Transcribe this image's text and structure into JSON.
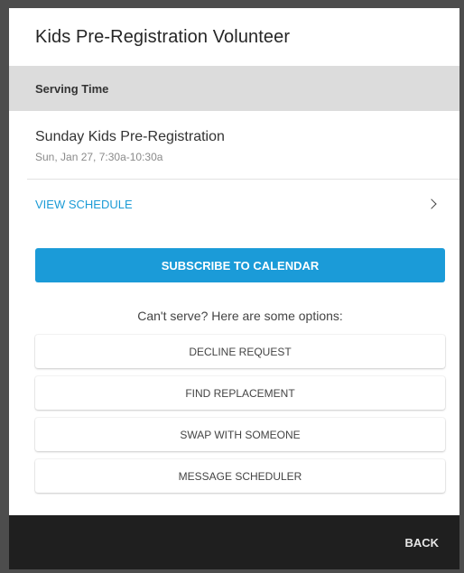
{
  "dialog": {
    "title": "Kids Pre-Registration Volunteer"
  },
  "section": {
    "header": "Serving Time"
  },
  "event": {
    "name": "Sunday Kids Pre-Registration",
    "time": "Sun, Jan 27, 7:30a-10:30a"
  },
  "schedule_link": {
    "label": "VIEW SCHEDULE",
    "icon": "chevron-right-icon"
  },
  "subscribe": {
    "label": "SUBSCRIBE TO CALENDAR",
    "color": "#1b9bd8"
  },
  "options": {
    "prompt": "Can't serve? Here are some options:",
    "buttons": [
      {
        "label": "DECLINE REQUEST"
      },
      {
        "label": "FIND REPLACEMENT"
      },
      {
        "label": "SWAP WITH SOMEONE"
      },
      {
        "label": "MESSAGE SCHEDULER"
      }
    ]
  },
  "footer": {
    "back_label": "BACK"
  }
}
